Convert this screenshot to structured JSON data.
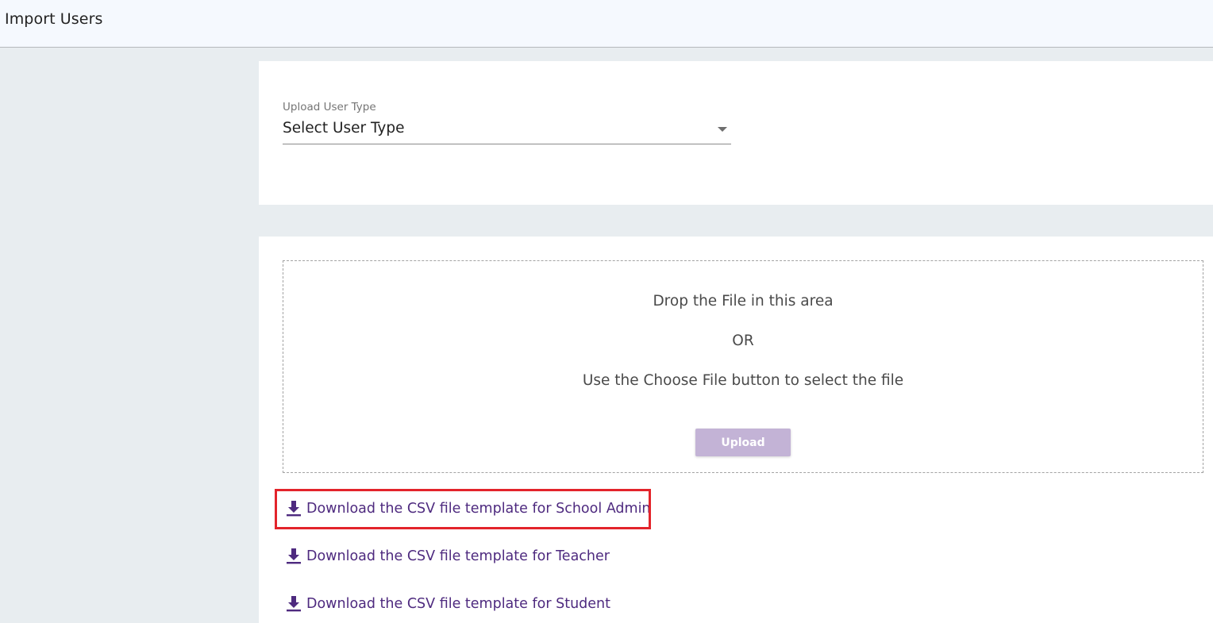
{
  "header": {
    "title": "Import Users"
  },
  "user_type_select": {
    "label": "Upload User Type",
    "value": "Select User Type"
  },
  "dropzone": {
    "line1": "Drop the File in this area",
    "line2": "OR",
    "line3": "Use the Choose File button to select the file",
    "upload_label": "Upload"
  },
  "downloads": [
    {
      "label": "Download the CSV file template for School Admin",
      "icon": "download-icon"
    },
    {
      "label": "Download the CSV file template for Teacher",
      "icon": "download-icon"
    },
    {
      "label": "Download the CSV file template for Student",
      "icon": "download-icon"
    }
  ],
  "colors": {
    "link": "#4e2a7f",
    "upload_button_disabled": "#c3b3d6",
    "highlight": "#e3242b",
    "page_background": "#e8edf0",
    "header_background": "#f5f9fe"
  }
}
